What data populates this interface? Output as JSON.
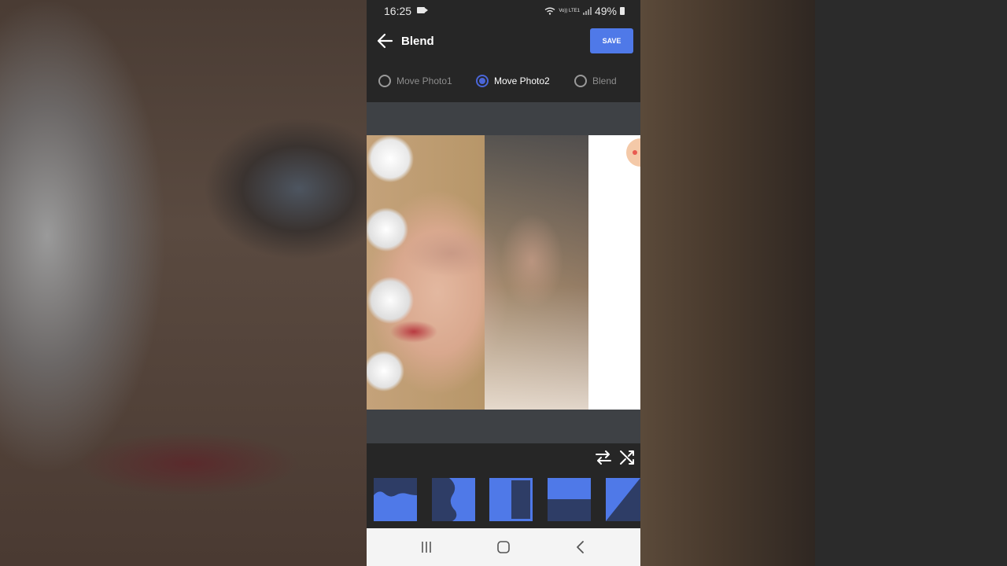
{
  "status_bar": {
    "time": "16:25",
    "network": "Vo)) LTE1",
    "battery": "49%"
  },
  "app_bar": {
    "title": "Blend",
    "save_label": "SAVE"
  },
  "modes": [
    {
      "label": "Move Photo1",
      "selected": false
    },
    {
      "label": "Move Photo2",
      "selected": true
    },
    {
      "label": "Blend",
      "selected": false
    }
  ],
  "tools": {
    "swap_icon": "swap-arrows-icon",
    "shuffle_icon": "shuffle-icon"
  },
  "mask_shapes": [
    "wave",
    "curve-split",
    "vertical-bar",
    "horizontal-split",
    "diagonal"
  ],
  "colors": {
    "accent": "#4f79e8",
    "radio_selected": "#4a66d8",
    "mask_dark": "#2e3d66",
    "mask_light": "#4f79e8"
  }
}
